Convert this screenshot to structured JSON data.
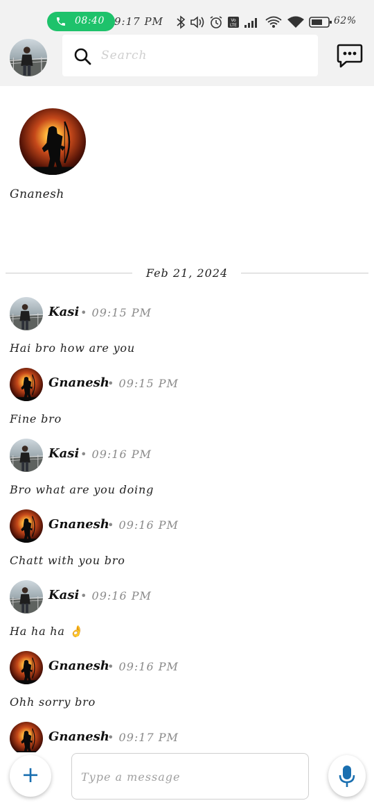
{
  "status_bar": {
    "call_time": "08:40",
    "clock": "9:17 PM",
    "battery": "62%",
    "call_color": "#1ec26b"
  },
  "header": {
    "search_placeholder": "Search"
  },
  "profile": {
    "name": "Gnanesh"
  },
  "date_divider": "Feb 21, 2024",
  "messages": [
    {
      "sender": "Kasi",
      "time": "• 09:15 PM",
      "text": "Hai bro how are you"
    },
    {
      "sender": "Gnanesh",
      "time": "• 09:15 PM",
      "text": "Fine bro"
    },
    {
      "sender": "Kasi",
      "time": "• 09:16 PM",
      "text": "Bro what are you doing"
    },
    {
      "sender": "Gnanesh",
      "time": "• 09:16 PM",
      "text": "Chatt with you bro"
    },
    {
      "sender": "Kasi",
      "time": "• 09:16 PM",
      "text": "Ha ha ha 👌"
    },
    {
      "sender": "Gnanesh",
      "time": "• 09:16 PM",
      "text": "Ohh sorry bro"
    },
    {
      "sender": "Gnanesh",
      "time": "• 09:17 PM",
      "text": ""
    }
  ],
  "composer": {
    "add_label": "+",
    "placeholder": "Type a message"
  },
  "colors": {
    "accent": "#1a6fb0",
    "header_bg": "#f2f2f2"
  }
}
